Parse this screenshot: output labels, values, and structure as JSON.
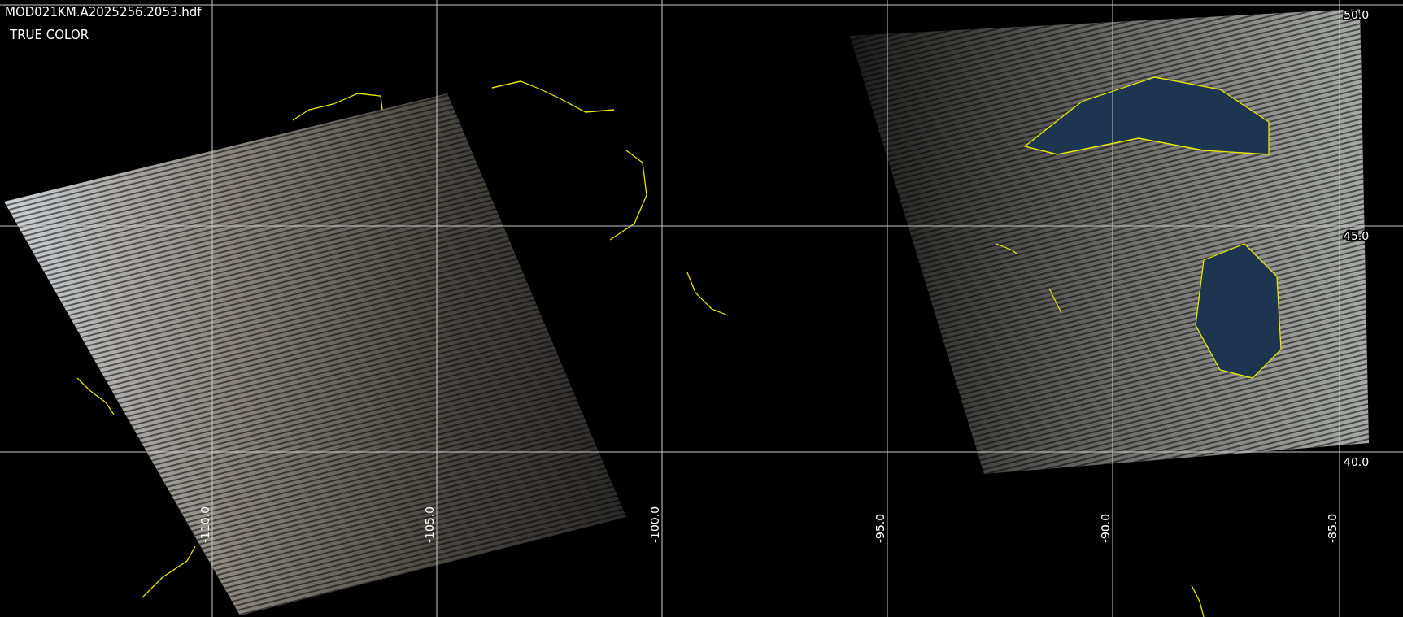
{
  "image_header": {
    "file_name": "MOD021KM.A2025256.2053.hdf",
    "band_mode": "TRUE COLOR"
  },
  "longitude_labels": [
    "-110.0",
    "-105.0",
    "-100.0",
    "-95.0",
    "-90.0",
    "-85.0"
  ],
  "latitude_labels": [
    "50.0",
    "45.0",
    "40.0"
  ]
}
